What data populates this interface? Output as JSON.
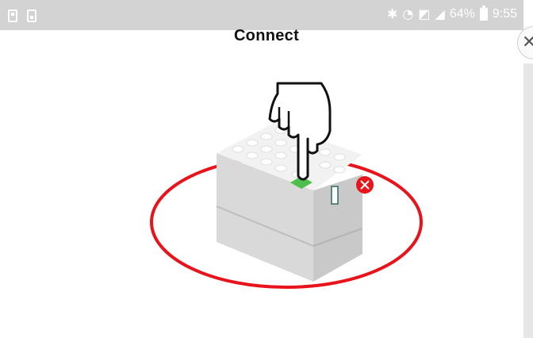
{
  "status_bar": {
    "battery_percent": "64%",
    "time": "9:55",
    "icons": [
      "notification-icon",
      "save-icon",
      "bluetooth-icon",
      "wifi-icon",
      "mute-icon",
      "signal-icon",
      "battery-icon"
    ]
  },
  "header": {
    "title": "Connect",
    "close_icon": "close-icon"
  },
  "illustration": {
    "accent_red": "#e8141b",
    "hub_green": "#4cbf4c",
    "status_badge_icon": "x-icon"
  }
}
